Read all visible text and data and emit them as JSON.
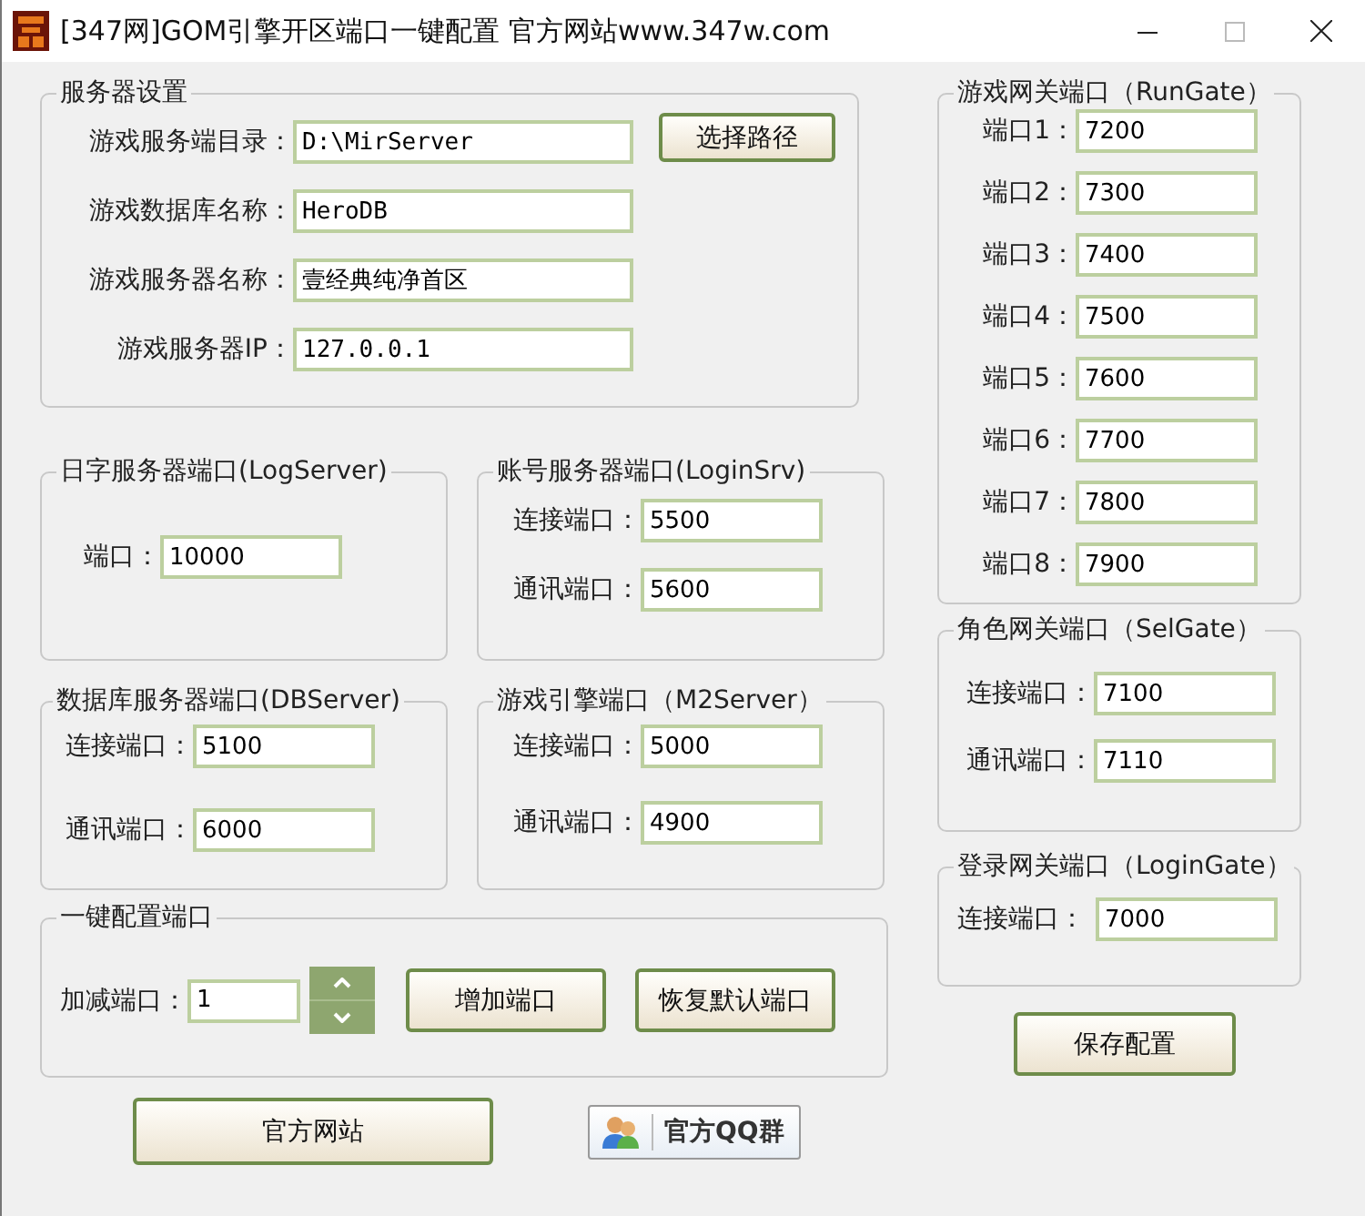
{
  "window": {
    "title": "[347网]GOM引擎开区端口一键配置  官方网站www.347w.com"
  },
  "server_settings": {
    "title": "服务器设置",
    "browse_button": "选择路径",
    "fields": [
      {
        "label": "游戏服务端目录：",
        "value": "D:\\MirServer"
      },
      {
        "label": "游戏数据库名称：",
        "value": "HeroDB"
      },
      {
        "label": "游戏服务器名称：",
        "value": "壹经典纯净首区"
      },
      {
        "label": "游戏服务器IP：",
        "value": "127.0.0.1"
      }
    ]
  },
  "port_groups": [
    {
      "title": "日字服务器端口(LogServer)",
      "fields": [
        {
          "label": "端口：",
          "value": "10000"
        }
      ]
    },
    {
      "title": "账号服务器端口(LoginSrv)",
      "fields": [
        {
          "label": "连接端口：",
          "value": "5500"
        },
        {
          "label": "通讯端口：",
          "value": "5600"
        }
      ]
    },
    {
      "title": "数据库服务器端口(DBServer)",
      "fields": [
        {
          "label": "连接端口：",
          "value": "5100"
        },
        {
          "label": "通讯端口：",
          "value": "6000"
        }
      ]
    },
    {
      "title": "游戏引擎端口（M2Server）",
      "fields": [
        {
          "label": "连接端口：",
          "value": "5000"
        },
        {
          "label": "通讯端口：",
          "value": "4900"
        }
      ]
    }
  ],
  "one_key": {
    "title": "一键配置端口",
    "label": "加减端口：",
    "value": "1",
    "buttons": [
      "增加端口",
      "恢复默认端口"
    ]
  },
  "website_button": "官方网站",
  "qq_button": "官方QQ群",
  "gate_groups": [
    {
      "title": "游戏网关端口（RunGate）",
      "fields": [
        {
          "label": "端口1：",
          "value": "7200"
        },
        {
          "label": "端口2：",
          "value": "7300"
        },
        {
          "label": "端口3：",
          "value": "7400"
        },
        {
          "label": "端口4：",
          "value": "7500"
        },
        {
          "label": "端口5：",
          "value": "7600"
        },
        {
          "label": "端口6：",
          "value": "7700"
        },
        {
          "label": "端口7：",
          "value": "7800"
        },
        {
          "label": "端口8：",
          "value": "7900"
        }
      ]
    },
    {
      "title": "角色网关端口（SelGate）",
      "fields": [
        {
          "label": "连接端口：",
          "value": "7100"
        },
        {
          "label": "通讯端口：",
          "value": "7110"
        }
      ]
    },
    {
      "title": "登录网关端口（LoginGate）",
      "fields": [
        {
          "label": "连接端口：",
          "value": "7000"
        }
      ]
    }
  ],
  "save_button": "保存配置"
}
